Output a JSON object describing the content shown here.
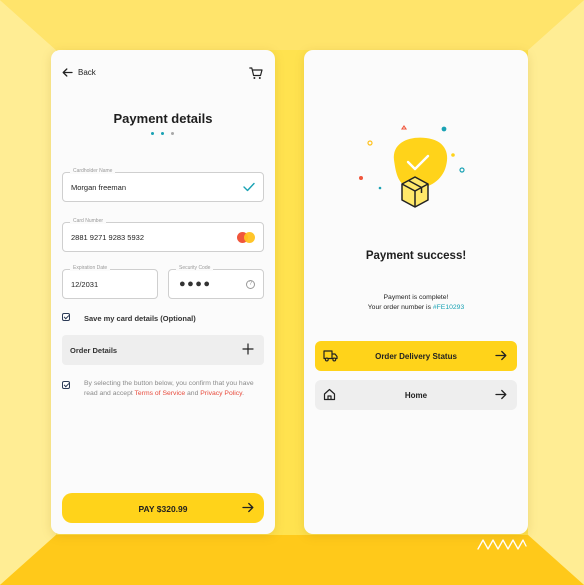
{
  "colors": {
    "accent_yellow": "#ffd31a",
    "teal": "#1aa2b4",
    "red_link": "#e84b3c",
    "card_bg": "#fbfbfb"
  },
  "payment_screen": {
    "back_label": "Back",
    "title": "Payment details",
    "cardholder": {
      "label": "Cardholder Name",
      "value": "Morgan freeman"
    },
    "card_number": {
      "label": "Card Number",
      "value": "2881 9271 9283 5932"
    },
    "expiry": {
      "label": "Expiration Date",
      "value": "12/2031"
    },
    "security": {
      "label": "Security Code",
      "value": "●●●●",
      "help": "?"
    },
    "save_card_label": "Save my card details (Optional)",
    "order_details_label": "Order Details",
    "terms": {
      "prefix": "By selecting the button below, you confirm that you have read and accept ",
      "tos_link": "Terms of Service",
      "middle": " and ",
      "privacy_link": "Privacy Policy",
      "suffix": "."
    },
    "pay_button_label": "PAY $320.99"
  },
  "success_screen": {
    "title": "Payment success!",
    "complete_text": "Payment is complete!",
    "order_prefix": "Your order number is ",
    "order_number": "#FE10293",
    "delivery_button_label": "Order Delivery Status",
    "home_button_label": "Home"
  },
  "icons": [
    "back-arrow-icon",
    "cart-icon",
    "checkmark-icon",
    "mastercard-icon",
    "help-icon",
    "plus-icon",
    "arrow-right-icon",
    "truck-icon",
    "home-icon",
    "package-icon"
  ]
}
